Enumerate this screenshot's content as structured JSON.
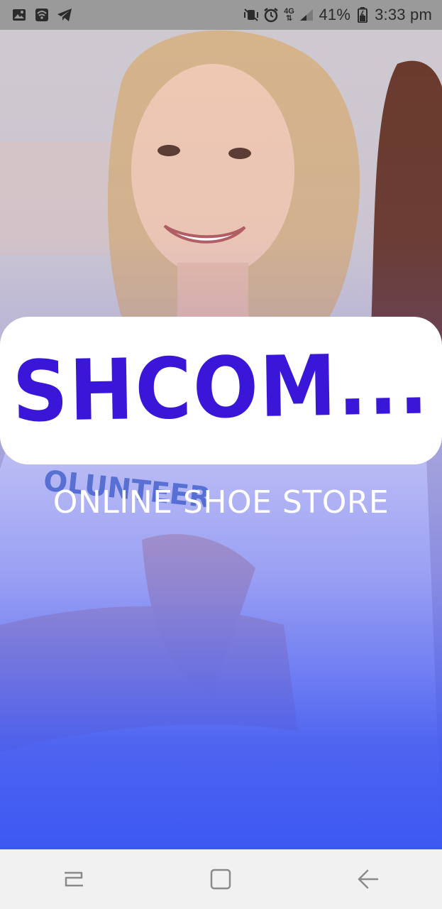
{
  "status_bar": {
    "battery_percent": "41%",
    "time": "3:33 pm",
    "network": "4G",
    "left_icons": [
      "image-icon",
      "wifi-hotspot-icon",
      "telegram-icon"
    ],
    "right_icons": [
      "mute-vibrate-icon",
      "alarm-icon",
      "network-4g-icon",
      "signal-icon",
      "battery-icon"
    ]
  },
  "splash": {
    "logo_text": "SHCOM...",
    "tagline": "ONLINE SHOE STORE"
  },
  "nav_bar": {
    "icons": [
      "recent-apps-icon",
      "home-icon",
      "back-icon"
    ]
  },
  "colors": {
    "logo": "#3a17d8",
    "gradient_bottom": "#3c58f2",
    "card": "#ffffff",
    "nav_bar": "#f1f1f1"
  }
}
